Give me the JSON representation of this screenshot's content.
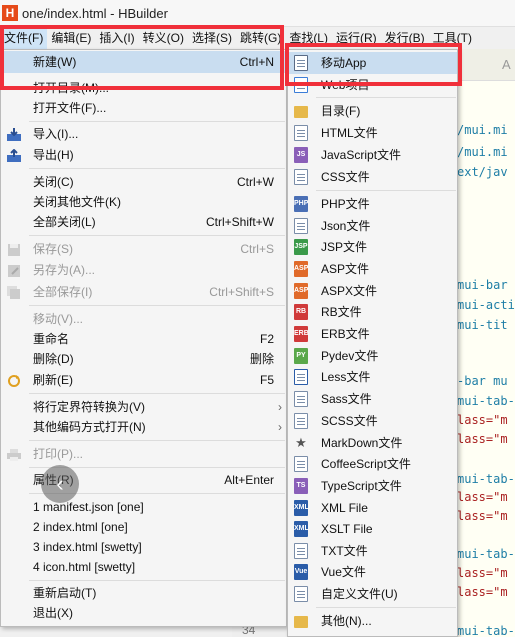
{
  "window": {
    "title": "one/index.html - HBuilder",
    "logo": "H"
  },
  "menubar": [
    "文件(F)",
    "编辑(E)",
    "插入(I)",
    "转义(O)",
    "选择(S)",
    "跳转(G)",
    "查找(L)",
    "运行(R)",
    "发行(B)",
    "工具(T)"
  ],
  "file_menu": {
    "new": {
      "label": "新建(W)",
      "shortcut": "Ctrl+N"
    },
    "open_dir": {
      "label": "打开目录(M)..."
    },
    "open_file": {
      "label": "打开文件(F)..."
    },
    "import": {
      "label": "导入(I)..."
    },
    "export": {
      "label": "导出(H)"
    },
    "close": {
      "label": "关闭(C)",
      "shortcut": "Ctrl+W"
    },
    "close_others": {
      "label": "关闭其他文件(K)"
    },
    "close_all": {
      "label": "全部关闭(L)",
      "shortcut": "Ctrl+Shift+W"
    },
    "save": {
      "label": "保存(S)",
      "shortcut": "Ctrl+S"
    },
    "save_as": {
      "label": "另存为(A)..."
    },
    "save_all": {
      "label": "全部保存(I)",
      "shortcut": "Ctrl+Shift+S"
    },
    "move": {
      "label": "移动(V)..."
    },
    "rename": {
      "label": "重命名",
      "shortcut": "F2"
    },
    "delete": {
      "label": "删除(D)",
      "shortcut": "删除"
    },
    "refresh": {
      "label": "刷新(E)",
      "shortcut": "F5"
    },
    "convert_eol": {
      "label": "将行定界符转换为(V)"
    },
    "reopen_encoding": {
      "label": "其他编码方式打开(N)"
    },
    "print": {
      "label": "打印(P)..."
    },
    "properties": {
      "label": "属性(R)",
      "shortcut": "Alt+Enter"
    },
    "recent": [
      "1 manifest.json  [one]",
      "2 index.html  [one]",
      "3 index.html  [swetty]",
      "4 icon.html  [swetty]"
    ],
    "restart": {
      "label": "重新启动(T)"
    },
    "exit": {
      "label": "退出(X)"
    }
  },
  "new_submenu": {
    "items": [
      {
        "label": "移动App",
        "icon": "mobile-app-icon",
        "color": "#5a6b86"
      },
      {
        "label": "Web项目",
        "icon": "web-project-icon",
        "color": "#3b7dd8"
      },
      {
        "label": "目录(F)",
        "icon": "folder-icon",
        "color": "#e6b84a"
      },
      {
        "label": "HTML文件",
        "icon": "html-file-icon",
        "color": "#7a8da8"
      },
      {
        "label": "JavaScript文件",
        "icon": "js-file-icon",
        "color": "#8a5fb8"
      },
      {
        "label": "CSS文件",
        "icon": "css-file-icon",
        "color": "#7a8da8"
      },
      {
        "label": "PHP文件",
        "icon": "php-file-icon",
        "color": "#4a6fb5"
      },
      {
        "label": "Json文件",
        "icon": "json-file-icon",
        "color": "#7a8da8"
      },
      {
        "label": "JSP文件",
        "icon": "jsp-file-icon",
        "color": "#3a9a4a"
      },
      {
        "label": "ASP文件",
        "icon": "asp-file-icon",
        "color": "#e06a2a"
      },
      {
        "label": "ASPX文件",
        "icon": "aspx-file-icon",
        "color": "#e06a2a"
      },
      {
        "label": "RB文件",
        "icon": "rb-file-icon",
        "color": "#d03a3a"
      },
      {
        "label": "ERB文件",
        "icon": "erb-file-icon",
        "color": "#d03a3a"
      },
      {
        "label": "Pydev文件",
        "icon": "python-file-icon",
        "color": "#5aa84a"
      },
      {
        "label": "Less文件",
        "icon": "less-file-icon",
        "color": "#2a5ca8"
      },
      {
        "label": "Sass文件",
        "icon": "sass-file-icon",
        "color": "#7a8da8"
      },
      {
        "label": "SCSS文件",
        "icon": "scss-file-icon",
        "color": "#7a8da8"
      },
      {
        "label": "MarkDown文件",
        "icon": "markdown-star-icon",
        "color": "#555555"
      },
      {
        "label": "CoffeeScript文件",
        "icon": "coffee-file-icon",
        "color": "#7a8da8"
      },
      {
        "label": "TypeScript文件",
        "icon": "ts-file-icon",
        "color": "#8a5fb8"
      },
      {
        "label": "XML File",
        "icon": "xml-file-icon",
        "color": "#2a5ca8"
      },
      {
        "label": "XSLT File",
        "icon": "xslt-file-icon",
        "color": "#2a5ca8"
      },
      {
        "label": "TXT文件",
        "icon": "txt-file-icon",
        "color": "#7a8da8"
      },
      {
        "label": "Vue文件",
        "icon": "vue-file-icon",
        "color": "#2a5ca8"
      },
      {
        "label": "自定义文件(U)",
        "icon": "custom-file-icon",
        "color": "#7a8da8"
      },
      {
        "label": "其他(N)...",
        "icon": "other-icon",
        "color": "#e6b84a"
      }
    ]
  },
  "editor": {
    "code_lines": [
      "/mui.mi",
      "/mui.mi",
      "ext/jav",
      "mui-bar",
      "mui-acti",
      "mui-tit",
      "-bar mu",
      "mui-tab-",
      "lass=\"m",
      "lass=\"m",
      "mui-tab-",
      "lass=\"m",
      "lass=\"m",
      "mui-tab-",
      "lass=\"m",
      "lass=\"m",
      "mui-tab-"
    ],
    "line_number": "34"
  },
  "colors": {
    "highlight_frame": "#f0303a",
    "selection": "#c9ddf0"
  }
}
